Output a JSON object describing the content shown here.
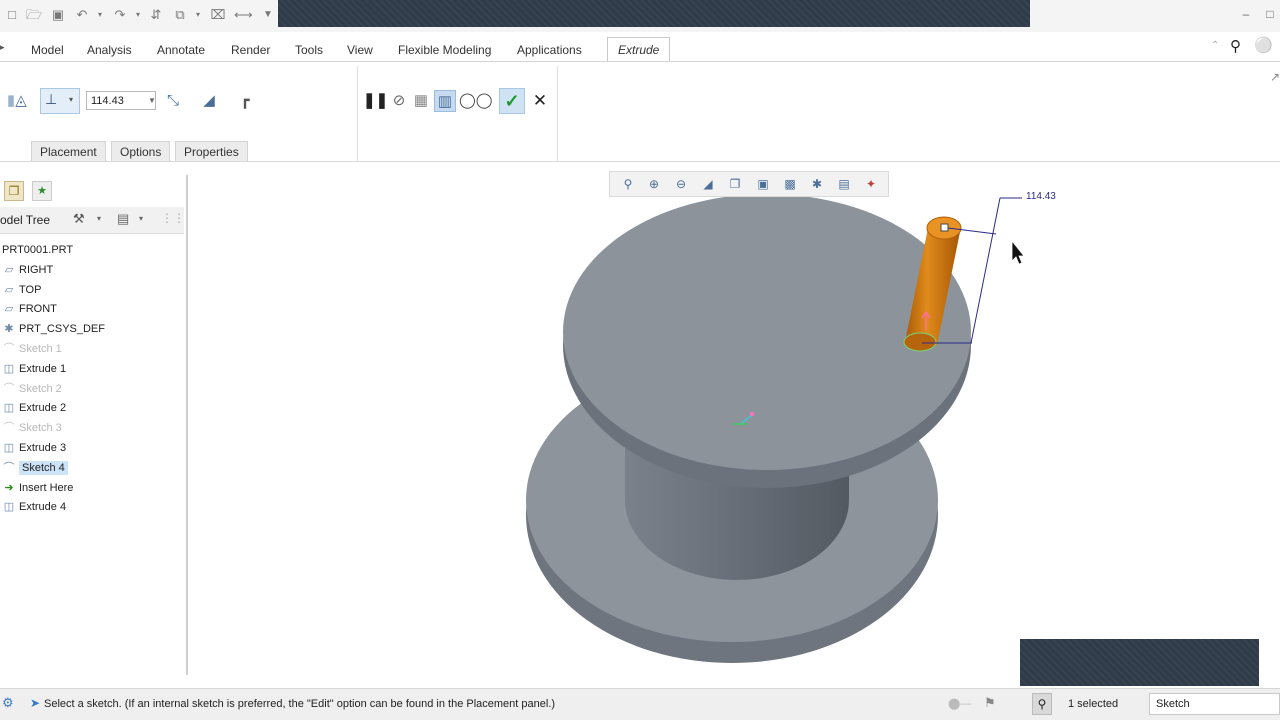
{
  "ribbon": {
    "tabs": [
      "Model",
      "Analysis",
      "Annotate",
      "Render",
      "Tools",
      "View",
      "Flexible Modeling",
      "Applications",
      "Extrude"
    ],
    "active_tab": "Extrude",
    "depth_value": "114.43",
    "subtabs": [
      "Placement",
      "Options",
      "Properties"
    ]
  },
  "model_tree": {
    "title": "odel Tree",
    "items": [
      {
        "label": "PRT0001.PRT",
        "icon": "part-icon",
        "state": "normal"
      },
      {
        "label": "RIGHT",
        "icon": "datum-plane-icon",
        "state": "normal"
      },
      {
        "label": "TOP",
        "icon": "datum-plane-icon",
        "state": "normal"
      },
      {
        "label": "FRONT",
        "icon": "datum-plane-icon",
        "state": "normal"
      },
      {
        "label": "PRT_CSYS_DEF",
        "icon": "csys-icon",
        "state": "normal"
      },
      {
        "label": "Sketch 1",
        "icon": "sketch-icon",
        "state": "dim"
      },
      {
        "label": "Extrude 1",
        "icon": "extrude-icon",
        "state": "normal"
      },
      {
        "label": "Sketch 2",
        "icon": "sketch-icon",
        "state": "dim"
      },
      {
        "label": "Extrude 2",
        "icon": "extrude-icon",
        "state": "normal"
      },
      {
        "label": "Sketch 3",
        "icon": "sketch-icon",
        "state": "dim"
      },
      {
        "label": "Extrude 3",
        "icon": "extrude-icon",
        "state": "normal"
      },
      {
        "label": "Sketch 4",
        "icon": "sketch-icon",
        "state": "selected"
      },
      {
        "label": "Insert Here",
        "icon": "insert-arrow-icon",
        "state": "normal"
      },
      {
        "label": "Extrude 4",
        "icon": "extrude-new-icon",
        "state": "normal"
      }
    ]
  },
  "viewport": {
    "dimension_label": "114.43",
    "model_color": "#8a9199",
    "feature_color": "#d07a10"
  },
  "status": {
    "message": "Select a sketch. (If an internal sketch is preferred, the \"Edit\" option can be found in the Placement panel.)",
    "selected_count": "1 selected",
    "filter": "Sketch"
  }
}
